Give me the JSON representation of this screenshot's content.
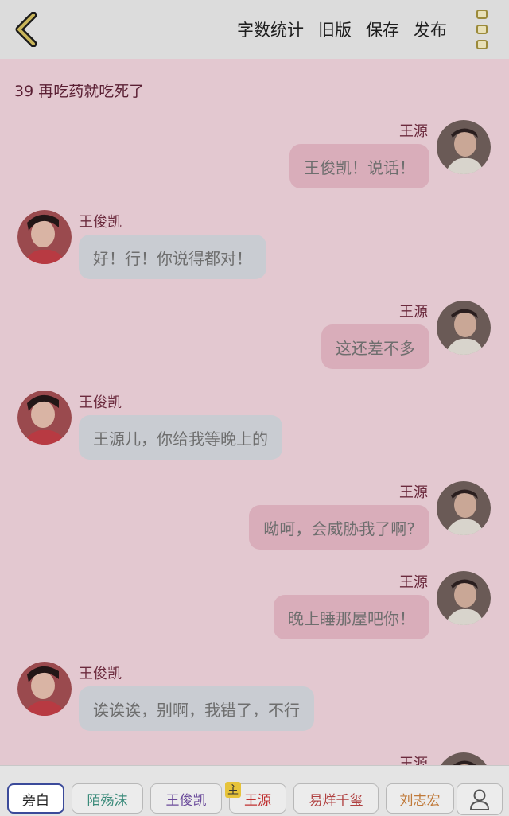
{
  "header": {
    "back_icon": "chevron-left-icon",
    "actions": [
      "字数统计",
      "旧版",
      "保存",
      "发布"
    ],
    "more_icon": "vertical-menu-icon",
    "accent_color": "#9b8a3a"
  },
  "chapter": {
    "title": "39 再吃药就吃死了"
  },
  "messages": [
    {
      "side": "right",
      "name": "王源",
      "text": "王俊凯！说话！"
    },
    {
      "side": "left",
      "name": "王俊凯",
      "text": "好！行！你说得都对！"
    },
    {
      "side": "right",
      "name": "王源",
      "text": "这还差不多"
    },
    {
      "side": "left",
      "name": "王俊凯",
      "text": "王源儿，你给我等晚上的"
    },
    {
      "side": "right",
      "name": "王源",
      "text": "呦呵，会威胁我了啊?"
    },
    {
      "side": "right",
      "name": "王源",
      "text": "晚上睡那屋吧你！"
    },
    {
      "side": "left",
      "name": "王俊凯",
      "text": "诶诶诶，别啊，我错了，不行"
    },
    {
      "side": "right",
      "name": "王源",
      "text": ""
    }
  ],
  "roles": [
    {
      "label": "旁白",
      "color": "#222222",
      "selected": true
    },
    {
      "label": "陌殇沫",
      "color": "#3a8a7a",
      "selected": false
    },
    {
      "label": "王俊凯",
      "color": "#6a4a9a",
      "selected": false
    },
    {
      "label": "王源",
      "color": "#c03030",
      "selected": false
    },
    {
      "label": "易烊千玺",
      "color": "#b04040",
      "selected": false
    },
    {
      "label": "刘志宏",
      "color": "#c07a3a",
      "selected": false
    }
  ],
  "main_badge": "主",
  "user_icon": "user-icon",
  "colors": {
    "right_bubble": "#d9adba",
    "left_bubble": "#c9ccd2",
    "content_bg": "#e3c8d0",
    "name_color": "#6b2a3d"
  }
}
